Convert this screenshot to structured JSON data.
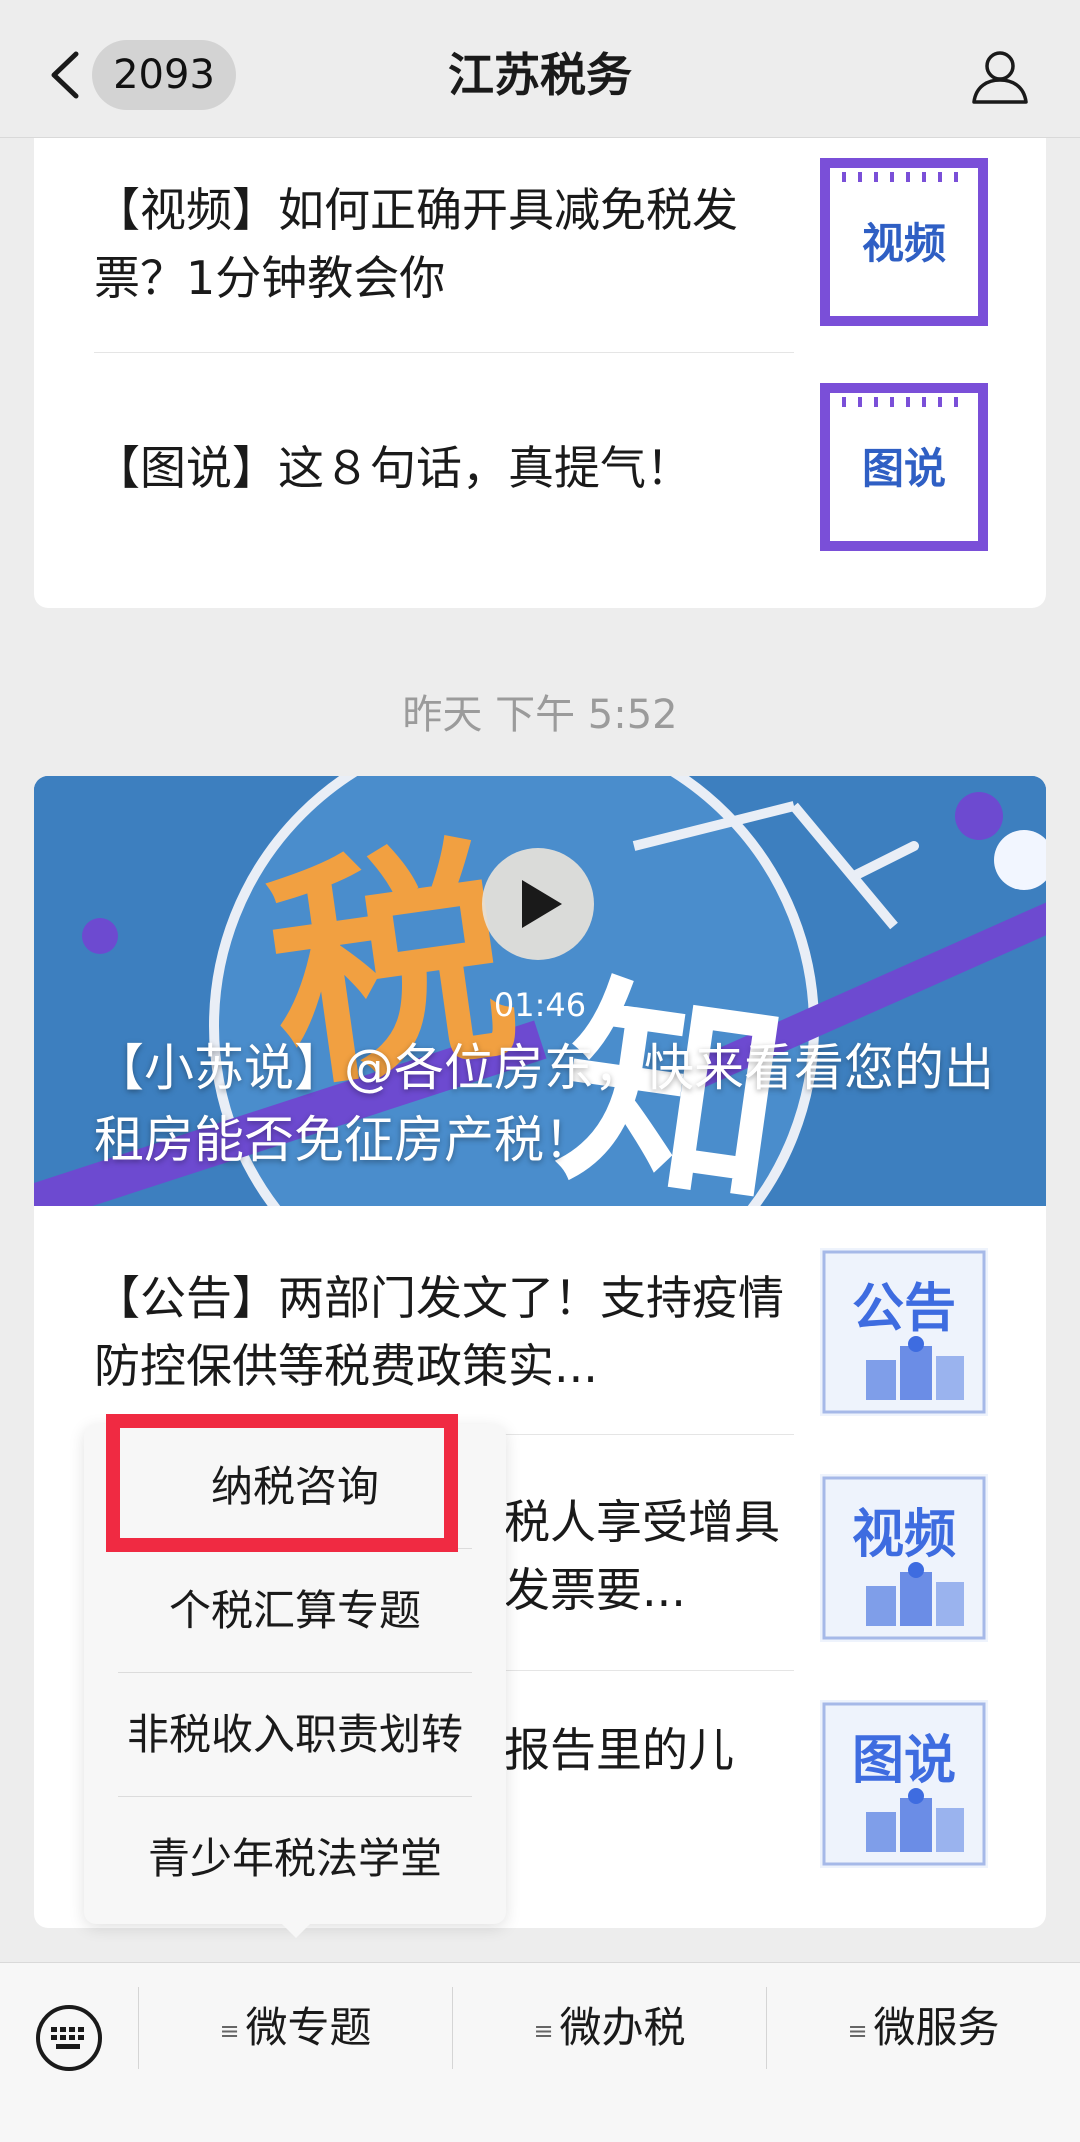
{
  "header": {
    "unread_count": "2093",
    "title": "江苏税务"
  },
  "timestamp": "昨天 下午 5:52",
  "group1": {
    "articles": [
      {
        "title": "【视频】如何正确开具减免税发票？1分钟教会你",
        "thumb_label": "视频"
      },
      {
        "title": "【图说】这８句话，真提气！",
        "thumb_label": "图说"
      }
    ]
  },
  "group2": {
    "hero": {
      "duration": "01:46",
      "title": "【小苏说】@各位房东，快来看看您的出租房能否免征房产税！",
      "bg_text": "税知"
    },
    "articles": [
      {
        "title": "【公告】两部门发文了！支持疫情防控保供等税费政策实...",
        "thumb_label": "公告"
      },
      {
        "title": "税人享受增具发票要...",
        "thumb_label": "视频"
      },
      {
        "title": "报告里的儿",
        "thumb_label": "图说"
      }
    ]
  },
  "popup": {
    "items": [
      "纳税咨询",
      "个税汇算专题",
      "非税收入职责划转",
      "青少年税法学堂"
    ]
  },
  "bottom_menu": {
    "tabs": [
      "微专题",
      "微办税",
      "微服务"
    ]
  },
  "colors": {
    "accent_purple": "#7a4fd8",
    "highlight_red": "#f02a42",
    "thumb_blue": "#2f5fc4"
  }
}
